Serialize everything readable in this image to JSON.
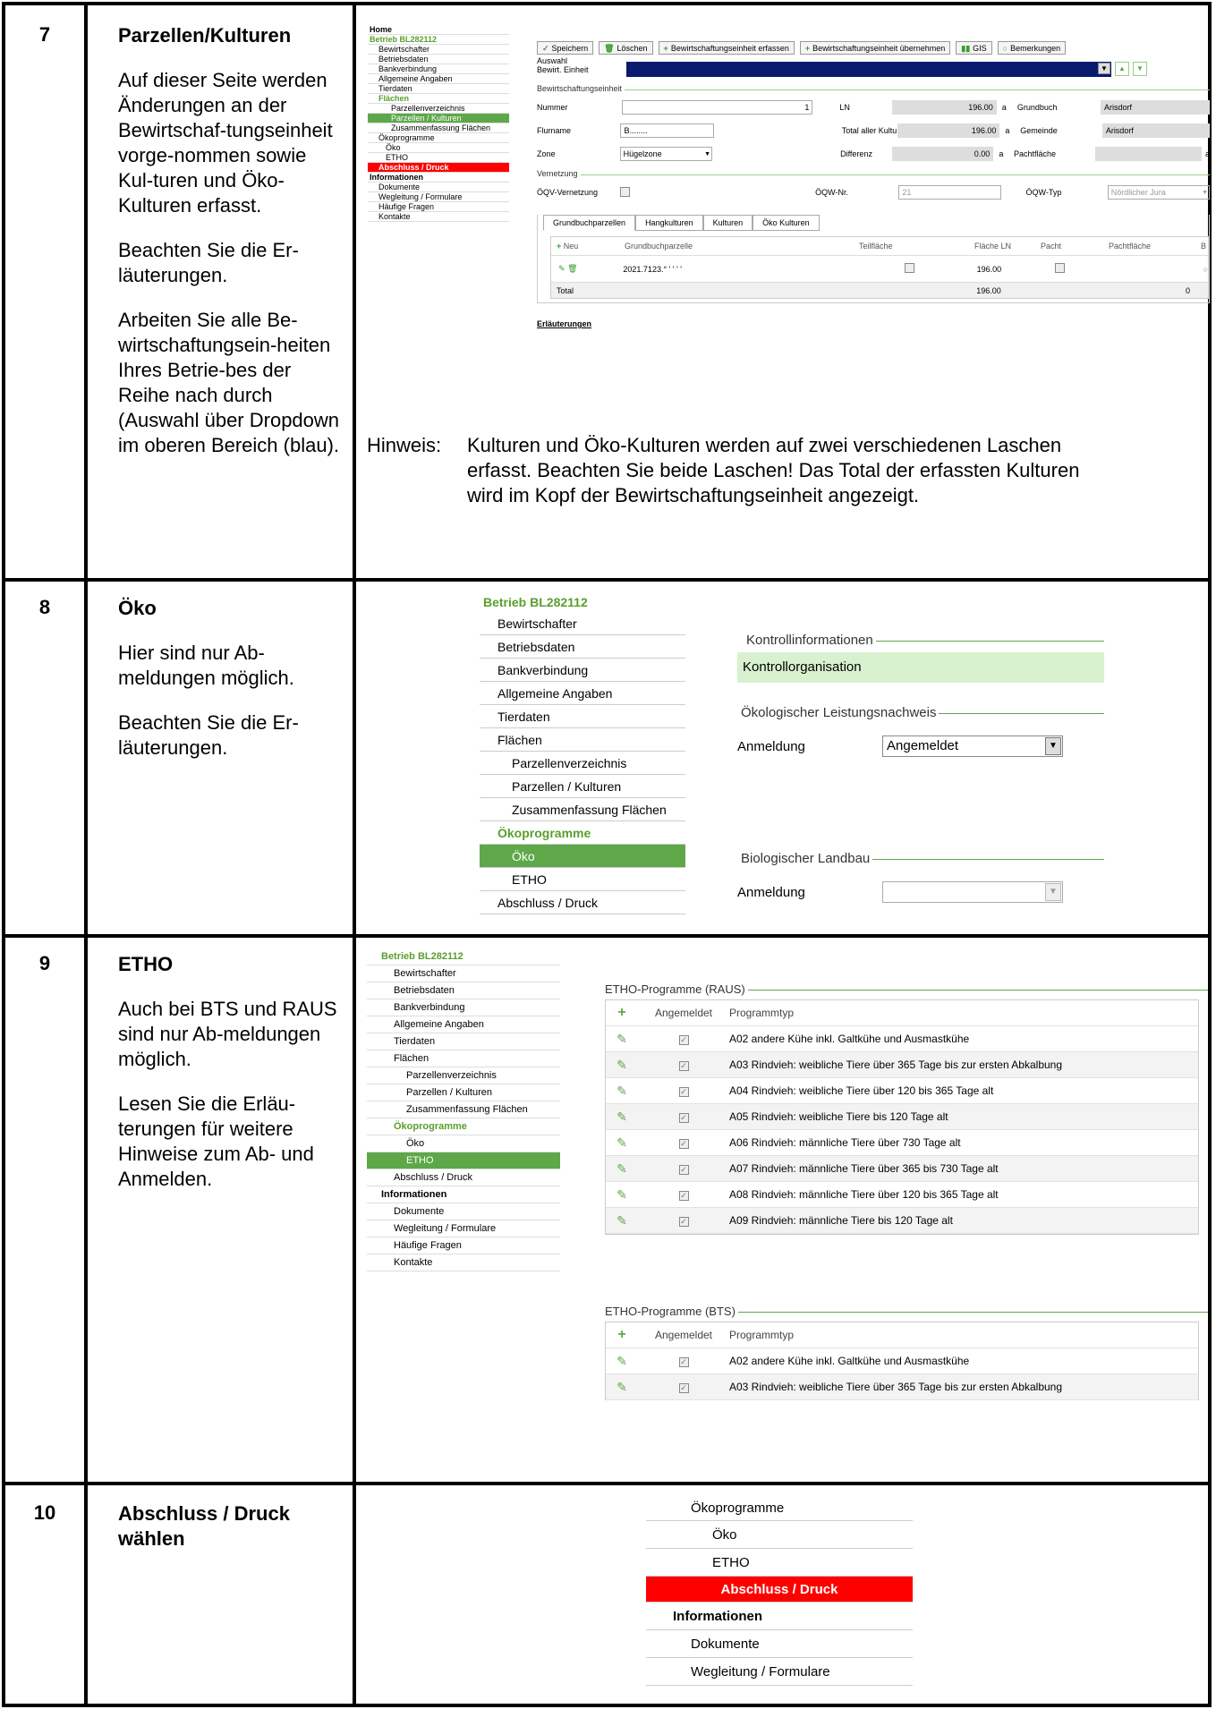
{
  "rows": [
    {
      "num": "7",
      "title": "Parzellen/Kulturen",
      "p1": "Auf dieser Seite werden Änderungen an der Bewirtschaf-tungseinheit vorge-nommen sowie Kul-turen und Öko-Kulturen erfasst.",
      "p2": "Beachten Sie die Er-läuterungen.",
      "p3": "Arbeiten Sie alle Be-wirtschaftungsein-heiten Ihres Betrie-bes der Reihe nach durch (Auswahl über Dropdown im oberen Bereich (blau)."
    },
    {
      "num": "8",
      "title": "Öko",
      "p1": "Hier sind nur Ab-meldungen möglich.",
      "p2": "Beachten Sie die Er-läuterungen."
    },
    {
      "num": "9",
      "title": "ETHO",
      "p1": "Auch bei BTS und RAUS sind nur Ab-meldungen möglich.",
      "p2": "Lesen Sie die Erläu-terungen für weitere Hinweise zum Ab- und Anmelden."
    },
    {
      "num": "10",
      "title": "Abschluss / Druck wählen"
    }
  ],
  "shot7": {
    "nav": [
      "Home",
      "Betrieb BL282112",
      "Bewirtschafter",
      "Betriebsdaten",
      "Bankverbindung",
      "Allgemeine Angaben",
      "Tierdaten",
      "Flächen",
      "Parzellenverzeichnis",
      "Parzellen / Kulturen",
      "Zusammenfassung Flächen",
      "Ökoprogramme",
      "Öko",
      "ETHO",
      "Abschluss / Druck",
      "Informationen",
      "Dokumente",
      "Wegleitung / Formulare",
      "Häufige Fragen",
      "Kontakte"
    ],
    "toolbar": {
      "save": "Speichern",
      "delete": "Löschen",
      "add": "Bewirtschaftungseinheit erfassen",
      "take": "Bewirtschaftungseinheit übernehmen",
      "gis": "GIS",
      "notes": "Bemerkungen"
    },
    "auswahl": "Auswahl",
    "bewirt": "Bewirt. Einheit",
    "section1": "Bewirtschaftungseinheit",
    "f": {
      "nummer": "Nummer",
      "nummer_v": "1",
      "ln": "LN",
      "ln_v": "196.00",
      "unit_a": "a",
      "grundbuch": "Grundbuch",
      "grundbuch_v": "Arisdorf",
      "flurname": "Flurname",
      "flurname_v": "B........",
      "total": "Total aller Kulturen",
      "total_v": "196.00",
      "gemeinde": "Gemeinde",
      "gemeinde_v": "Arisdorf",
      "zone": "Zone",
      "zone_v": "Hügelzone",
      "diff": "Differenz",
      "diff_v": "0.00",
      "pacht": "Pachtfläche"
    },
    "section2": "Vernetzung",
    "v": {
      "oqv": "ÖQV-Vernetzung",
      "nr": "ÖQW-Nr.",
      "nr_v": "21",
      "typ": "ÖQW-Typ",
      "typ_v": "Nördlicher Jura"
    },
    "tabs": [
      "Grundbuchparzellen",
      "Hangkulturen",
      "Kulturen",
      "Öko Kulturen"
    ],
    "tbl": {
      "neu": "Neu",
      "gbp": "Grundbuchparzelle",
      "teil": "Teilfläche",
      "fln": "Fläche LN",
      "pacht": "Pacht",
      "pachtfl": "Pachtfläche",
      "b": "B",
      "row_gbp": "2021.7123.° ' ' ' '",
      "row_fln": "196.00",
      "total": "Total",
      "total_fln": "196.00",
      "total_b": "0"
    },
    "erl": "Erläuterungen"
  },
  "hinweis": {
    "label": "Hinweis:",
    "text": "Kulturen und Öko-Kulturen werden auf zwei verschiedenen Laschen erfasst. Beachten Sie beide Laschen! Das Total der erfassten Kulturen wird im Kopf der Bewirtschaftungseinheit angezeigt."
  },
  "shot8": {
    "nav": [
      "Betrieb BL282112",
      "Bewirtschafter",
      "Betriebsdaten",
      "Bankverbindung",
      "Allgemeine Angaben",
      "Tierdaten",
      "Flächen",
      "Parzellenverzeichnis",
      "Parzellen / Kulturen",
      "Zusammenfassung Flächen",
      "Ökoprogramme",
      "Öko",
      "ETHO",
      "Abschluss / Druck"
    ],
    "kontroll": "Kontrollinformationen",
    "kontrollorg": "Kontrollorganisation",
    "oeln": "Ökologischer Leistungsnachweis",
    "anmeldung": "Anmeldung",
    "oeln_v": "Angemeldet",
    "bio": "Biologischer Landbau",
    "anmeldung2": "Anmeldung",
    "bio_v": ""
  },
  "shot9": {
    "nav": [
      "Betrieb BL282112",
      "Bewirtschafter",
      "Betriebsdaten",
      "Bankverbindung",
      "Allgemeine Angaben",
      "Tierdaten",
      "Flächen",
      "Parzellenverzeichnis",
      "Parzellen / Kulturen",
      "Zusammenfassung Flächen",
      "Ökoprogramme",
      "Öko",
      "ETHO",
      "Abschluss / Druck",
      "Informationen",
      "Dokumente",
      "Wegleitung / Formulare",
      "Häufige Fragen",
      "Kontakte"
    ],
    "raus_title": "ETHO-Programme (RAUS)",
    "bts_title": "ETHO-Programme (BTS)",
    "col_angemeldet": "Angemeldet",
    "col_typ": "Programmtyp",
    "raus": [
      "A02 andere Kühe inkl. Galtkühe und Ausmastkühe",
      "A03 Rindvieh: weibliche Tiere über 365 Tage bis zur ersten Abkalbung",
      "A04 Rindvieh: weibliche Tiere über 120 bis 365 Tage alt",
      "A05 Rindvieh: weibliche Tiere bis 120 Tage alt",
      "A06 Rindvieh: männliche Tiere über 730 Tage alt",
      "A07 Rindvieh: männliche Tiere über 365 bis 730 Tage alt",
      "A08 Rindvieh: männliche Tiere über 120 bis 365 Tage alt",
      "A09 Rindvieh: männliche Tiere bis 120 Tage alt"
    ],
    "bts": [
      "A02 andere Kühe inkl. Galtkühe und Ausmastkühe",
      "A03 Rindvieh: weibliche Tiere über 365 Tage bis zur ersten Abkalbung"
    ]
  },
  "shot10": {
    "nav": [
      "Ökoprogramme",
      "Öko",
      "ETHO",
      "Abschluss / Druck",
      "Informationen",
      "Dokumente",
      "Wegleitung / Formulare"
    ]
  },
  "colors": {
    "green": "#5ea84a",
    "red": "#ff0000",
    "blue": "#0a1a6e",
    "lightgreen": "#d8f1cf"
  }
}
